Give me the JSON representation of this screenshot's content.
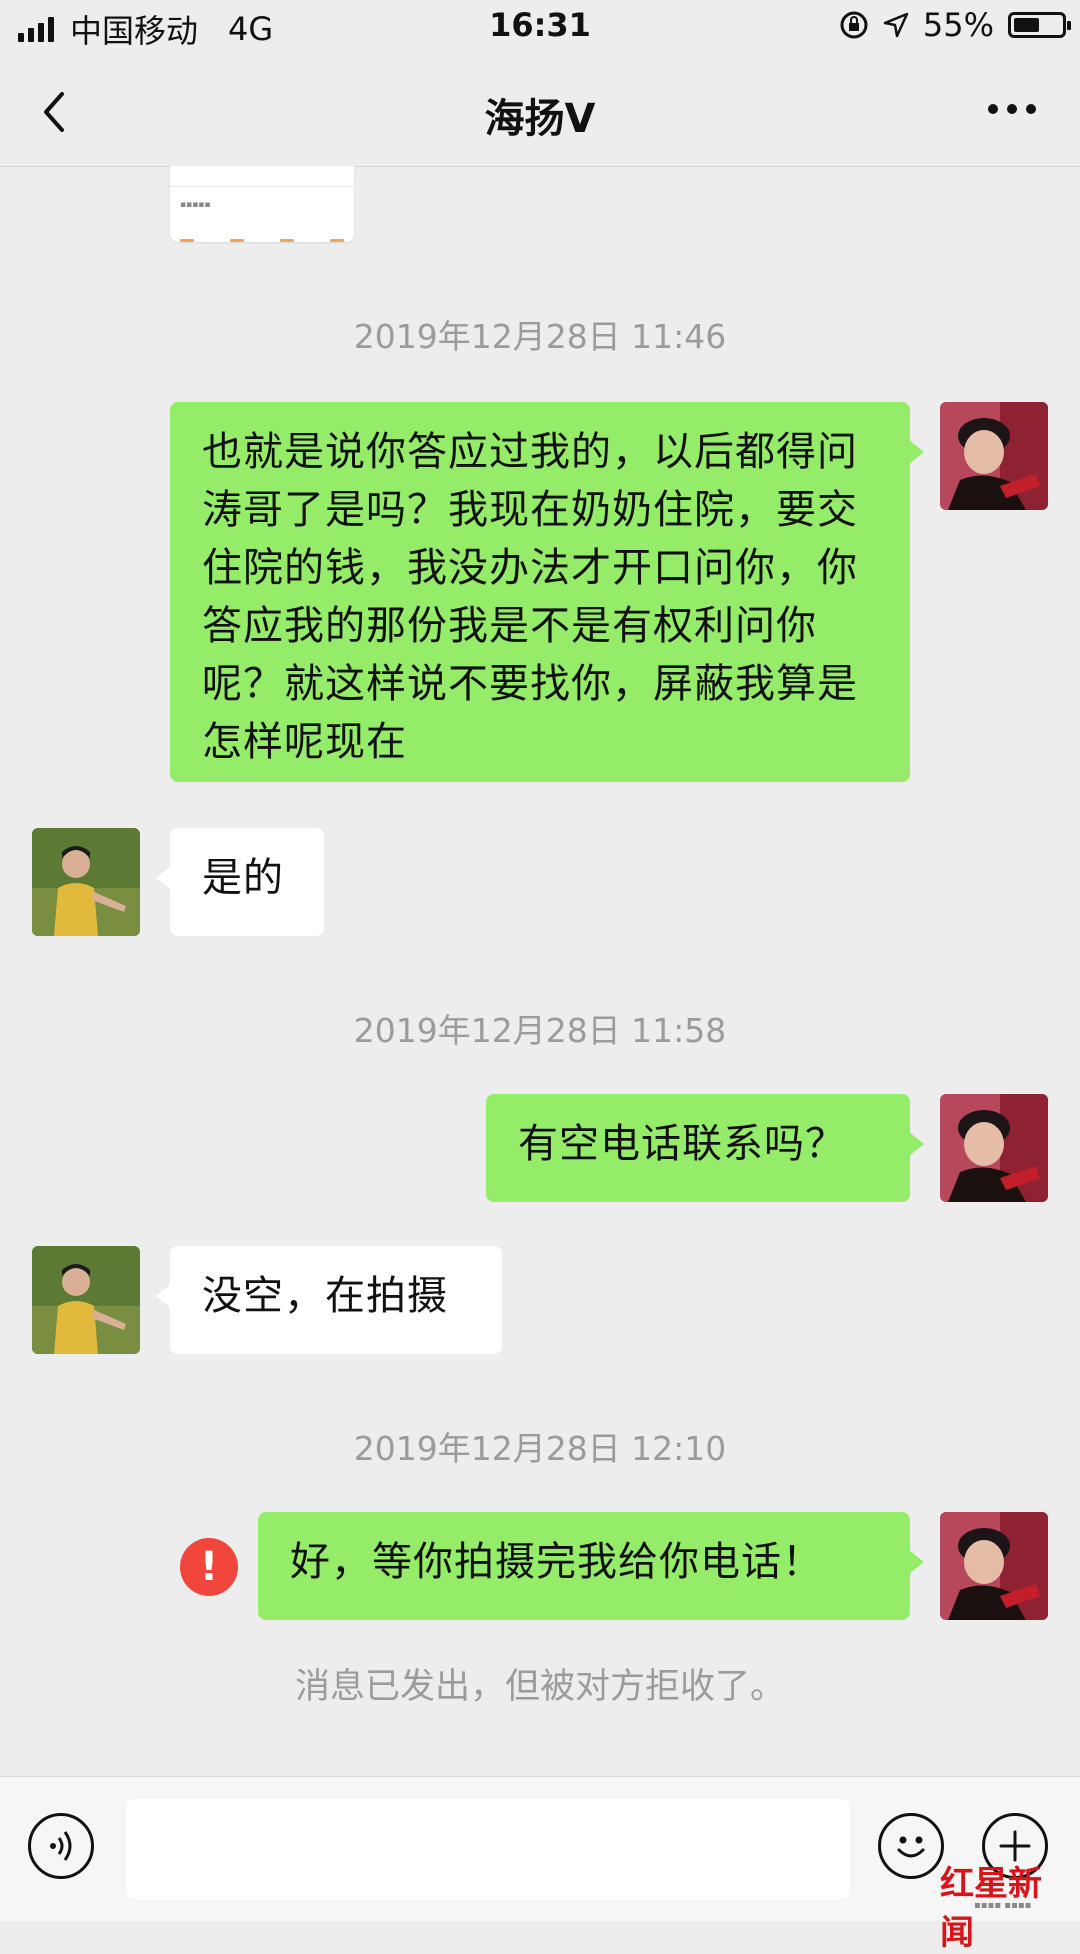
{
  "status_bar": {
    "carrier": "中国移动",
    "network": "4G",
    "time": "16:31",
    "battery": "55%",
    "battery_level": 0.55
  },
  "header": {
    "title": "海扬V",
    "back_icon": "chevron-left-icon",
    "more_icon": "more-dots-icon"
  },
  "messages": {
    "ts1": "2019年12月28日 11:46",
    "m1": "也就是说你答应过我的，以后都得问涛哥了是吗？我现在奶奶住院，要交住院的钱，我没办法才开口问你，你答应我的那份我是不是有权利问你呢？就这样说不要找你，屏蔽我算是怎样呢现在",
    "m2": "是的",
    "ts2": "2019年12月28日 11:58",
    "m3": "有空电话联系吗？",
    "m4": "没空，在拍摄",
    "ts3": "2019年12月28日 12:10",
    "m5": "好，等你拍摄完我给你电话！",
    "fail_mark": "!",
    "rejected_note": "消息已发出，但被对方拒收了。"
  },
  "input_bar": {
    "voice_icon": "voice-icon",
    "emoji_icon": "emoji-icon",
    "plus_icon": "plus-icon"
  },
  "watermark": {
    "logo": "红星新闻"
  },
  "colors": {
    "background": "#ededed",
    "outgoing_bubble": "#95ec69",
    "incoming_bubble": "#ffffff",
    "timestamp": "#9b9b9b",
    "fail_red": "#f0463c"
  }
}
